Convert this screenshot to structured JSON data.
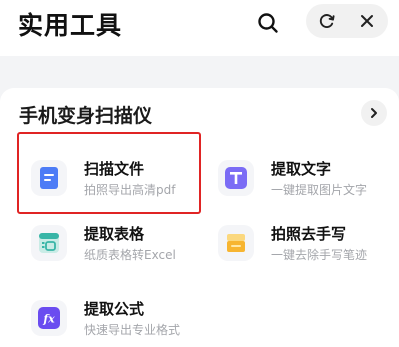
{
  "header": {
    "title": "实用工具",
    "search_icon": "search-icon",
    "capsule_left_icon": "refresh-icon",
    "capsule_right_icon": "close-icon"
  },
  "section": {
    "title": "手机变身扫描仪",
    "more_icon": "chevron-right-icon"
  },
  "tools": [
    {
      "name": "扫描文件",
      "desc": "拍照导出高清pdf",
      "icon": "document-scan-icon",
      "color": "#4d7cf6"
    },
    {
      "name": "提取文字",
      "desc": "一键提取图片文字",
      "icon": "text-extract-icon",
      "color": "#7b6cf5"
    },
    {
      "name": "提取表格",
      "desc": "纸质表格转Excel",
      "icon": "table-extract-icon",
      "color": "#38b5a7"
    },
    {
      "name": "拍照去手写",
      "desc": "一键去除手写笔迹",
      "icon": "erase-handwriting-icon",
      "color": "#f7b531"
    },
    {
      "name": "提取公式",
      "desc": "快速导出专业格式",
      "icon": "formula-extract-icon",
      "color": "#6a4cf0"
    }
  ],
  "colors": {
    "highlight": "#e02424",
    "background": "#f3f4f6"
  }
}
